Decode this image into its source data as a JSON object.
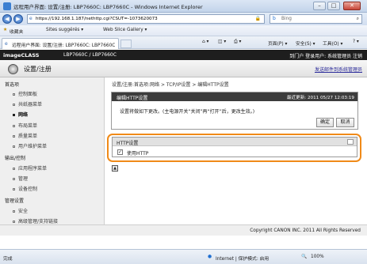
{
  "window": {
    "title": "远程用户界面: 设置/注册: LBP7660C: LBP7660C - Windows Internet Explorer",
    "minimize": "–",
    "maximize": "□",
    "close": "✕"
  },
  "browser": {
    "address": "https://192.168.1.187/nethttp.cgi?CSUT=-1073620073",
    "search_placeholder": "Bing",
    "favorites_label": "收藏夹",
    "favorites": [
      "Sites suggérés ▾",
      "Web Slice Gallery ▾"
    ],
    "tab_label": "远程用户界面: 设置/注册: LBP7660C: LBP7660C",
    "commands": [
      "页面(P) ▾",
      "安全(S) ▾",
      "工具(O) ▾"
    ]
  },
  "header": {
    "brand": "imageCLASS",
    "model": "LBP7660C / LBP7660C",
    "links": "到门户  登录用户: 系统管理员  注销",
    "title": "设置/注册",
    "mail_link": "发送邮件到系统管理员"
  },
  "sidebar": {
    "sections": [
      {
        "label": "首选项",
        "items": [
          "控制面板",
          "共纸器菜单",
          "网络",
          "布局菜单",
          "质量菜单",
          "用户维护菜单"
        ]
      },
      {
        "label": "输出/控制",
        "items": [
          "应用程序菜单",
          "管理",
          "设备控制"
        ]
      },
      {
        "label": "管理设置",
        "items": [
          "安全",
          "高级管理/支持链接"
        ]
      }
    ],
    "active": "网络"
  },
  "main": {
    "breadcrumb": "设置/注册:首选项:网络 > TCP/IP设置 > 编辑HTTP设置",
    "panel_title": "编辑HTTP设置",
    "last_updated": "最近更新: 2011 05/27 12:03:19",
    "message": "设置将做如下更改。(主电源开关“关闭”再“打开”后，更改生效。)",
    "ok_label": "确定",
    "cancel_label": "取消",
    "http_section": "HTTP设置",
    "use_http_label": "使用HTTP",
    "use_http_checked": true
  },
  "footer": {
    "copyright": "Copyright CANON INC. 2011 All Rights Reserved"
  },
  "status": {
    "left": "完成",
    "zone": "Internet | 保护模式: 启用",
    "zoom": "100%"
  }
}
